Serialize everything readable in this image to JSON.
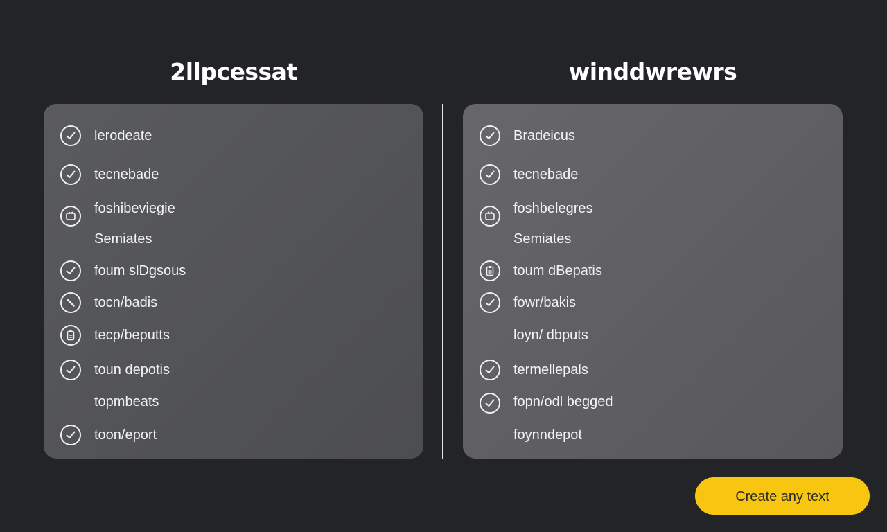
{
  "left": {
    "title": "2llpcessat",
    "items": [
      {
        "label": "lerodeate",
        "icon": "check-icon"
      },
      {
        "label": "tecnebade",
        "icon": "check-icon"
      },
      {
        "label": "foshibeviegie",
        "icon": "tv-icon"
      },
      {
        "label": "Semiates",
        "icon": ""
      },
      {
        "label": "foum slDgsous",
        "icon": "check-icon"
      },
      {
        "label": "tocn/badis",
        "icon": "pen-icon"
      },
      {
        "label": "tecp/beputts",
        "icon": "clipboard-icon"
      },
      {
        "label": "toun depotis",
        "icon": "check-icon"
      },
      {
        "label": "topmbeats",
        "icon": ""
      },
      {
        "label": "toon/eport",
        "icon": "check-icon"
      }
    ]
  },
  "right": {
    "title": "winddwrewrs",
    "items": [
      {
        "label": "Bradeicus",
        "icon": "check-icon"
      },
      {
        "label": "tecnebade",
        "icon": "check-icon"
      },
      {
        "label": "foshbelegres",
        "icon": "tv-icon"
      },
      {
        "label": "Semiates",
        "icon": ""
      },
      {
        "label": "toum dBepatis",
        "icon": "clipboard-icon"
      },
      {
        "label": "fowr/bakis",
        "icon": "check-icon"
      },
      {
        "label": "loyn/ dbputs",
        "icon": ""
      },
      {
        "label": "termellepals",
        "icon": "check-icon"
      },
      {
        "label": "fopn/odl begged",
        "icon": "check-icon"
      },
      {
        "label": "foynndepot",
        "icon": ""
      }
    ]
  },
  "cta": {
    "label": "Create any text",
    "color": "#f8c610"
  },
  "colors": {
    "background": "#232427",
    "panel_left": "#55565a",
    "panel_right": "#5f5f63",
    "text": "#f3f3f3"
  }
}
